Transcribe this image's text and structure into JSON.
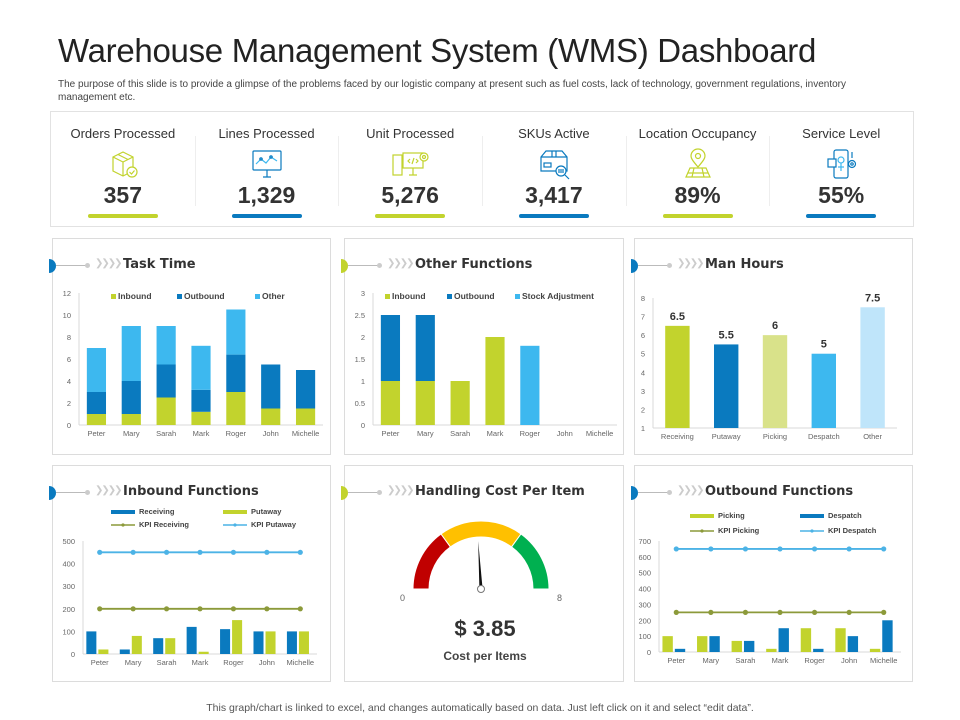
{
  "header": {
    "title": "Warehouse Management System (WMS) Dashboard",
    "subtitle": "The purpose of this slide is to provide a glimpse of the problems faced by our logistic company at present such as fuel costs, lack of technology, government regulations, inventory management etc."
  },
  "colors": {
    "green": "#c2d32d",
    "blue": "#0a7abf",
    "light_blue": "#3db8ef",
    "pale_green": "#d9e28a",
    "pale_blue": "#bfe5fa",
    "kpi_olive": "#8c9a3a",
    "kpi_sky": "#4cb3e6",
    "gauge_red": "#c00000",
    "gauge_yellow": "#ffc000",
    "gauge_green": "#00b050"
  },
  "kpis": [
    {
      "label": "Orders Processed",
      "value": "357",
      "icon": "package-check-icon",
      "bar_color": "green"
    },
    {
      "label": "Lines Processed",
      "value": "1,329",
      "icon": "monitor-chart-icon",
      "bar_color": "blue"
    },
    {
      "label": "Unit Processed",
      "value": "5,276",
      "icon": "computer-code-gear-icon",
      "bar_color": "green"
    },
    {
      "label": "SKUs Active",
      "value": "3,417",
      "icon": "box-barcode-search-icon",
      "bar_color": "blue"
    },
    {
      "label": "Location Occupancy",
      "value": "89%",
      "icon": "map-pin-icon",
      "bar_color": "green"
    },
    {
      "label": "Service Level",
      "value": "55%",
      "icon": "phone-robot-gear-icon",
      "bar_color": "blue"
    }
  ],
  "cards": {
    "task_time": {
      "title": "Task Time"
    },
    "other_functions": {
      "title": "Other Functions"
    },
    "man_hours": {
      "title": "Man Hours"
    },
    "inbound_functions": {
      "title": "Inbound Functions"
    },
    "handling_cost": {
      "title": "Handling Cost Per Item",
      "value_text": "$ 3.85",
      "caption": "Cost per Items"
    },
    "outbound_functions": {
      "title": "Outbound Functions"
    }
  },
  "footer": {
    "text": "This graph/chart is linked to excel, and changes automatically based on data. Just left click on it and select “edit data”."
  },
  "chart_data": [
    {
      "id": "task_time",
      "type": "bar",
      "stacked": true,
      "title": "Task Time",
      "categories": [
        "Peter",
        "Mary",
        "Sarah",
        "Mark",
        "Roger",
        "John",
        "Michelle"
      ],
      "series": [
        {
          "name": "Inbound",
          "color": "green",
          "values": [
            1,
            1,
            2.5,
            1.2,
            3,
            1.5,
            1.5
          ]
        },
        {
          "name": "Outbound",
          "color": "blue",
          "values": [
            2,
            3,
            3,
            2,
            3.4,
            4,
            3.5
          ]
        },
        {
          "name": "Other",
          "color": "light_blue",
          "values": [
            4,
            5,
            3.5,
            4,
            4.1,
            0,
            0
          ]
        }
      ],
      "yticks": [
        0,
        2,
        4,
        6,
        8,
        10,
        12
      ],
      "ylim": [
        0,
        12
      ],
      "legend": "top"
    },
    {
      "id": "other_functions",
      "type": "bar",
      "stacked": true,
      "title": "Other Functions",
      "categories": [
        "Peter",
        "Mary",
        "Sarah",
        "Mark",
        "Roger",
        "John",
        "Michelle"
      ],
      "series": [
        {
          "name": "Inbound",
          "color": "green",
          "values": [
            1,
            1,
            1,
            2,
            0,
            0,
            0
          ]
        },
        {
          "name": "Outbound",
          "color": "blue",
          "values": [
            1.5,
            1.5,
            0,
            0,
            0,
            0,
            0
          ]
        },
        {
          "name": "Stock Adjustment",
          "color": "light_blue",
          "values": [
            0,
            0,
            0,
            0,
            1.8,
            0,
            0
          ]
        }
      ],
      "yticks": [
        0,
        0.5,
        1,
        1.5,
        2,
        2.5,
        3
      ],
      "ylim": [
        0,
        3
      ],
      "legend": "top"
    },
    {
      "id": "man_hours",
      "type": "bar",
      "title": "Man Hours",
      "categories": [
        "Receiving",
        "Putaway",
        "Picking",
        "Despatch",
        "Other"
      ],
      "values": [
        6.5,
        5.5,
        6,
        5,
        7.5
      ],
      "labels": [
        "6.5",
        "5.5",
        "6",
        "5",
        "7.5"
      ],
      "bar_colors": [
        "green",
        "blue",
        "pale_green",
        "light_blue",
        "pale_blue"
      ],
      "yticks": [
        1,
        2,
        3,
        4,
        5,
        6,
        7,
        8
      ],
      "ylim": [
        1,
        8
      ]
    },
    {
      "id": "inbound_functions",
      "type": "bar",
      "title": "Inbound Functions",
      "categories": [
        "Peter",
        "Mary",
        "Sarah",
        "Mark",
        "Roger",
        "John",
        "Michelle"
      ],
      "series": [
        {
          "name": "Receiving",
          "kind": "bar",
          "color": "blue",
          "values": [
            100,
            20,
            70,
            120,
            110,
            100,
            100
          ]
        },
        {
          "name": "Putaway",
          "kind": "bar",
          "color": "green",
          "values": [
            20,
            80,
            70,
            10,
            150,
            100,
            100
          ]
        },
        {
          "name": "KPI Receiving",
          "kind": "line",
          "color": "kpi_olive",
          "values": [
            200,
            200,
            200,
            200,
            200,
            200,
            200
          ]
        },
        {
          "name": "KPI Putaway",
          "kind": "line",
          "color": "kpi_sky",
          "values": [
            450,
            450,
            450,
            450,
            450,
            450,
            450
          ]
        }
      ],
      "yticks": [
        0,
        100,
        200,
        300,
        400,
        500
      ],
      "ylim": [
        0,
        500
      ],
      "legend": "top"
    },
    {
      "id": "handling_cost",
      "type": "gauge",
      "title": "Handling Cost Per Item",
      "min": 0,
      "max": 8,
      "min_label": "0",
      "max_label": "8",
      "value": 3.85,
      "bands": [
        {
          "from": 0,
          "to": 2.4,
          "color": "gauge_red"
        },
        {
          "from": 2.4,
          "to": 5.6,
          "color": "gauge_yellow"
        },
        {
          "from": 5.6,
          "to": 8,
          "color": "gauge_green"
        }
      ]
    },
    {
      "id": "outbound_functions",
      "type": "bar",
      "title": "Outbound Functions",
      "categories": [
        "Peter",
        "Mary",
        "Sarah",
        "Mark",
        "Roger",
        "John",
        "Michelle"
      ],
      "series": [
        {
          "name": "Picking",
          "kind": "bar",
          "color": "green",
          "values": [
            100,
            100,
            70,
            20,
            150,
            150,
            20
          ]
        },
        {
          "name": "Despatch",
          "kind": "bar",
          "color": "blue",
          "values": [
            20,
            100,
            70,
            150,
            20,
            100,
            200
          ]
        },
        {
          "name": "KPI Picking",
          "kind": "line",
          "color": "kpi_olive",
          "values": [
            250,
            250,
            250,
            250,
            250,
            250,
            250
          ]
        },
        {
          "name": "KPI Despatch",
          "kind": "line",
          "color": "kpi_sky",
          "values": [
            650,
            650,
            650,
            650,
            650,
            650,
            650
          ]
        }
      ],
      "yticks": [
        0,
        100,
        200,
        300,
        400,
        500,
        600,
        700
      ],
      "ylim": [
        0,
        700
      ],
      "legend": "top"
    }
  ]
}
